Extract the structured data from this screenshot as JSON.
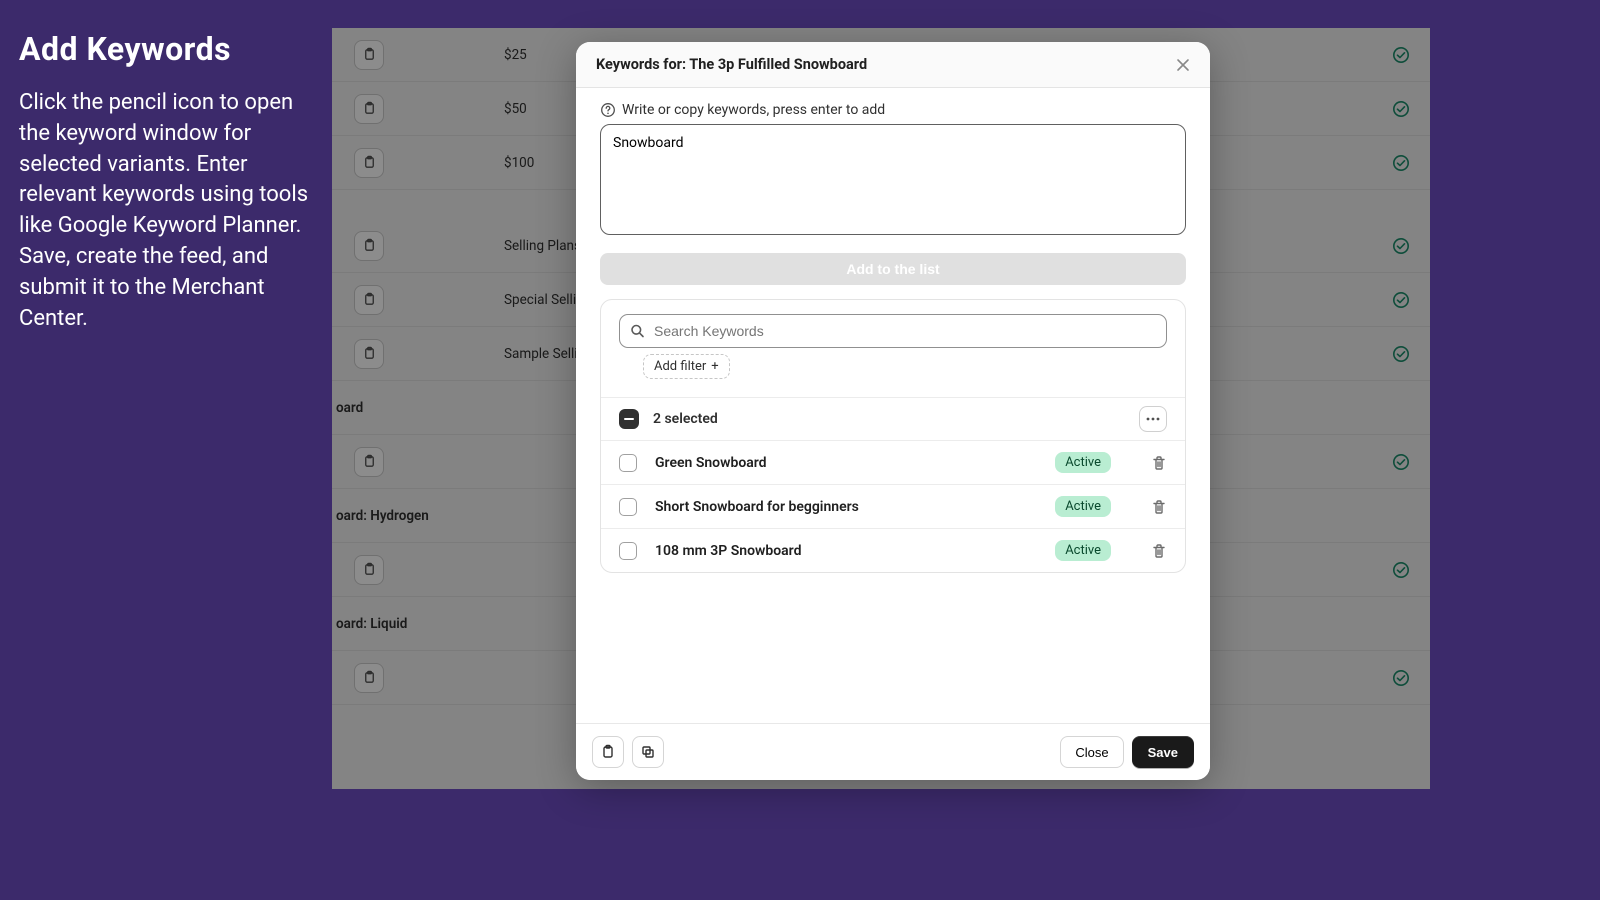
{
  "leftPanel": {
    "title": "Add Keywords",
    "body": "Click the pencil icon to open the keyword window for selected variants. Enter relevant keywords using tools like Google Keyword Planner. Save, create the feed, and submit it to the Merchant Center."
  },
  "bgRows": [
    {
      "type": "item",
      "label": "$25"
    },
    {
      "type": "item",
      "label": "$50"
    },
    {
      "type": "item",
      "label": "$100"
    },
    {
      "type": "spacer"
    },
    {
      "type": "item",
      "label": "Selling Plans S"
    },
    {
      "type": "item",
      "label": "Special Selling"
    },
    {
      "type": "item",
      "label": "Sample Selling"
    },
    {
      "type": "group",
      "label": "oard"
    },
    {
      "type": "item",
      "label": ""
    },
    {
      "type": "group",
      "label": "oard: Hydrogen"
    },
    {
      "type": "item",
      "label": ""
    },
    {
      "type": "group",
      "label": "oard: Liquid"
    },
    {
      "type": "item",
      "label": ""
    }
  ],
  "modal": {
    "header": {
      "title": "Keywords for: The 3p Fulfilled Snowboard"
    },
    "inputLabel": "Write or copy keywords, press enter to add",
    "textareaValue": "Snowboard",
    "addButton": "Add to the list",
    "searchPlaceholder": "Search Keywords",
    "addFilterLabel": "Add filter",
    "selectedText": "2 selected",
    "items": [
      {
        "name": "Green Snowboard",
        "status": "Active"
      },
      {
        "name": "Short Snowboard for begginners",
        "status": "Active"
      },
      {
        "name": "108 mm 3P Snowboard",
        "status": "Active"
      }
    ],
    "footer": {
      "close": "Close",
      "save": "Save"
    }
  }
}
